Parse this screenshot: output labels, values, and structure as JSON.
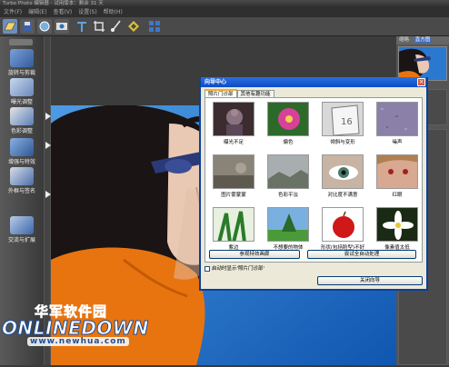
{
  "app": {
    "title": "Turbo Photo 编辑器 - 试用版本：剩余 31 天"
  },
  "menu": {
    "items": [
      "文件(F)",
      "编辑(E)",
      "查看(V)",
      "设置(S)",
      "帮助(H)"
    ]
  },
  "toolbar": {
    "icons": [
      "open-icon",
      "save-icon",
      "print-icon",
      "web-icon",
      "text-icon",
      "crop-icon",
      "brush-icon",
      "frame-icon",
      "layout-icon"
    ]
  },
  "sidebar": {
    "items": [
      {
        "label": "旋转与剪裁",
        "icon": "rotate-icon"
      },
      {
        "label": "曝光调整",
        "icon": "exposure-icon"
      },
      {
        "label": "色彩调整",
        "icon": "color-icon"
      },
      {
        "label": "增强与特效",
        "icon": "effects-icon"
      },
      {
        "label": "外框与签名",
        "icon": "frame-icon"
      },
      {
        "label": "交流与扩展",
        "icon": "share-icon"
      }
    ]
  },
  "right_panel": {
    "tabs": [
      "缩略",
      "直方图"
    ]
  },
  "dialog": {
    "title": "向导中心",
    "tabs": [
      "照片门诊部",
      "其他有趣功能"
    ],
    "cells": [
      {
        "label": "曝光不足",
        "icon": "underexposed-thumb-icon"
      },
      {
        "label": "偏色",
        "icon": "color-cast-thumb-icon"
      },
      {
        "label": "倾斜与变形",
        "icon": "skew-thumb-icon"
      },
      {
        "label": "噪声",
        "icon": "noise-thumb-icon"
      },
      {
        "label": "图片雾蒙蒙",
        "icon": "foggy-thumb-icon"
      },
      {
        "label": "色彩平淡",
        "icon": "flat-color-thumb-icon"
      },
      {
        "label": "对比度不满意",
        "icon": "contrast-thumb-icon"
      },
      {
        "label": "红眼",
        "icon": "red-eye-thumb-icon"
      },
      {
        "label": "紫边",
        "icon": "purple-fringe-thumb-icon"
      },
      {
        "label": "不想要的物体",
        "icon": "unwanted-object-thumb-icon"
      },
      {
        "label": "形状(包括脸型)不好",
        "icon": "shape-thumb-icon"
      },
      {
        "label": "像素值太低",
        "icon": "low-pixel-thumb-icon"
      }
    ],
    "btn_help": "参观特效画廊",
    "btn_auto": "尝试全自动处理",
    "checkbox_label": "启动时显示'照片门诊部'",
    "btn_close": "关闭向导"
  },
  "watermark": {
    "cn": "华军软件园",
    "en": "ONLINEDOWN",
    "url": "www.newhua.com"
  },
  "colors": {
    "sky": "#1f6fc8",
    "dialog_title": "#0b4cc6",
    "shirt": "#e8740f"
  }
}
